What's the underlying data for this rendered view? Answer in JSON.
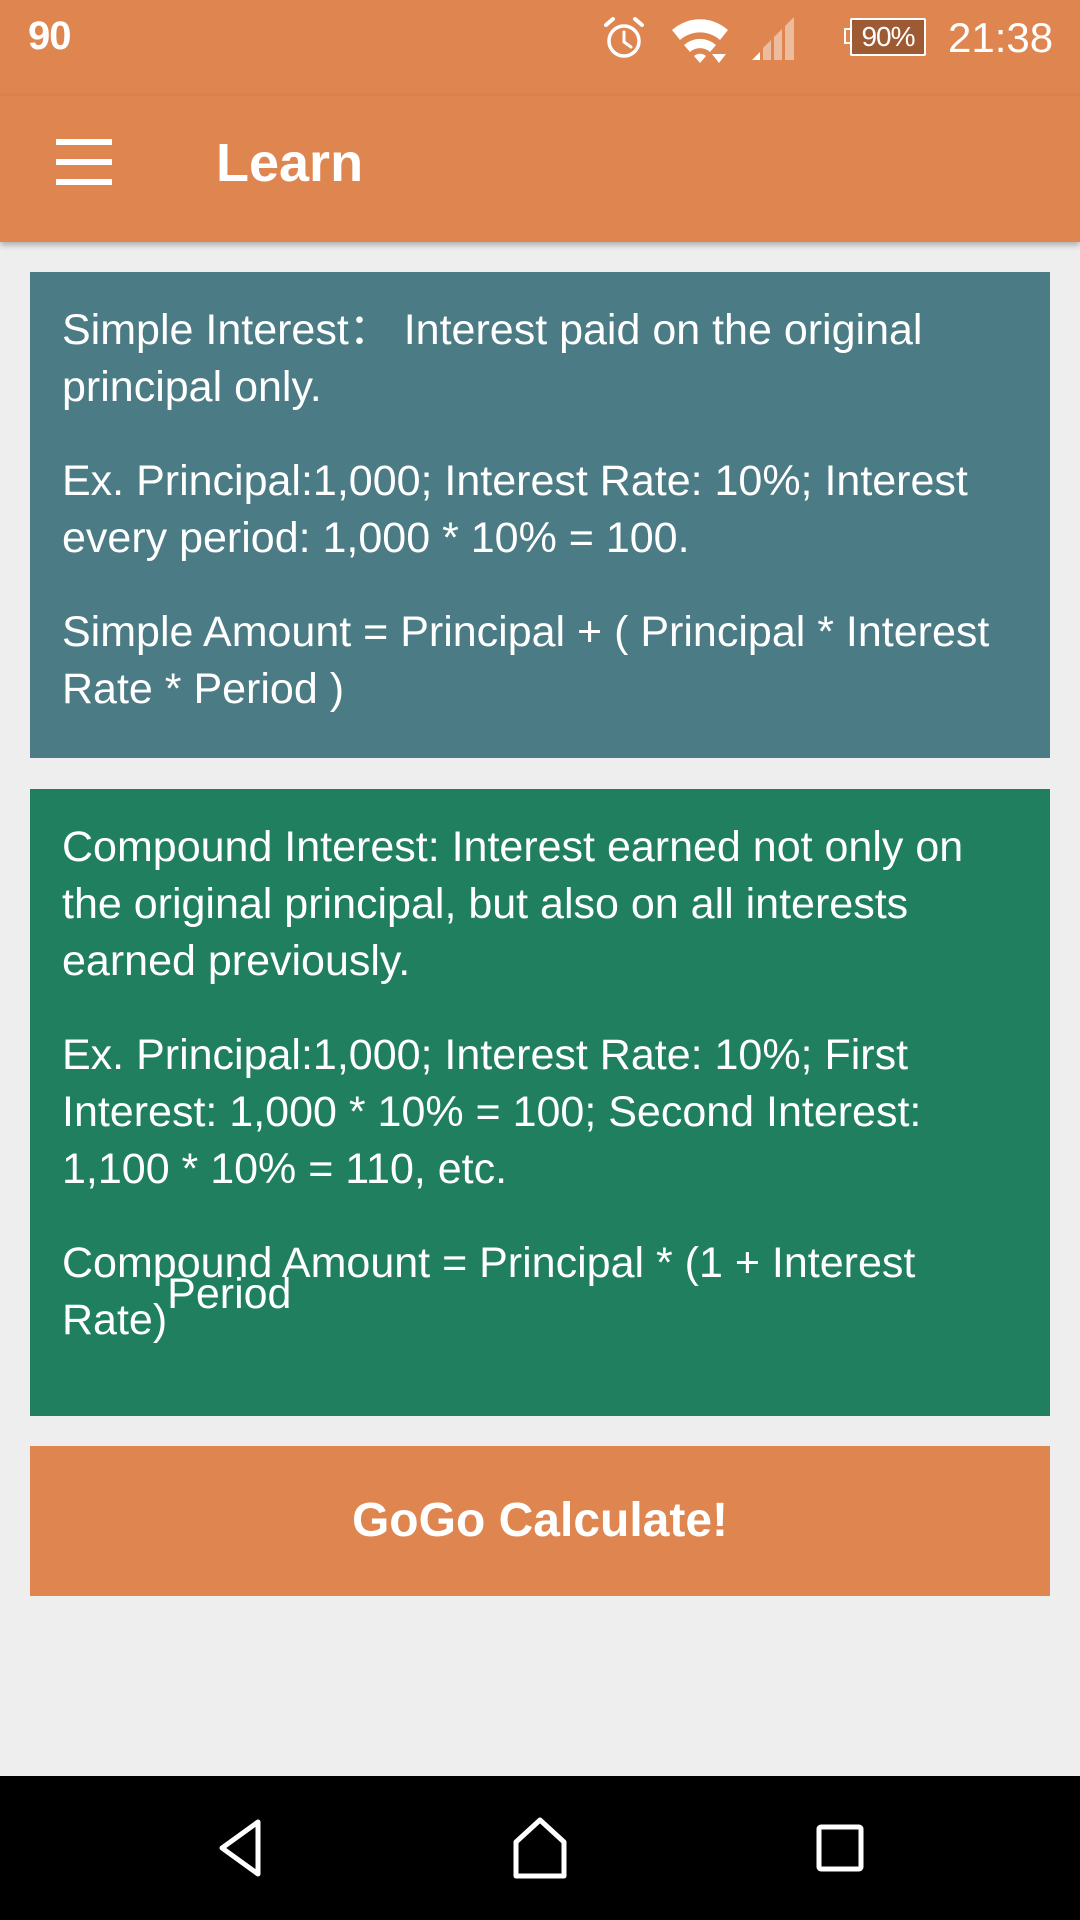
{
  "status_bar": {
    "left_text": "90",
    "icons": [
      "alarm-icon",
      "wifi-icon",
      "cell-signal-icon",
      "battery-icon"
    ],
    "battery_percent": "90%",
    "time": "21:38"
  },
  "toolbar": {
    "menu_icon": "hamburger-menu-icon",
    "title": "Learn"
  },
  "cards": {
    "simple": {
      "definition": "Simple Interest：  Interest paid on the original principal only.",
      "example": "Ex. Principal:1,000; Interest Rate: 10%; Interest every period: 1,000 * 10% = 100.",
      "formula": "Simple Amount = Principal + ( Principal * Interest Rate * Period )"
    },
    "compound": {
      "definition": "Compound Interest: Interest earned not only on the original principal, but also on all interests earned previously.",
      "example": "Ex. Principal:1,000; Interest Rate: 10%; First Interest: 1,000 * 10% = 100; Second Interest: 1,100 * 10% = 110, etc.",
      "formula_base": "Compound Amount = Principal * (1 + Interest Rate)",
      "formula_exponent": "Period"
    }
  },
  "button": {
    "label": "GoGo Calculate!"
  },
  "nav_bar": {
    "buttons": [
      "back-icon",
      "home-icon",
      "recents-icon"
    ]
  },
  "colors": {
    "primary": "#DE8550",
    "simple_card": "#4B7B84",
    "compound_card": "#207F5E",
    "background": "#EEEEEE",
    "battery_fill": "#9E5A33"
  }
}
